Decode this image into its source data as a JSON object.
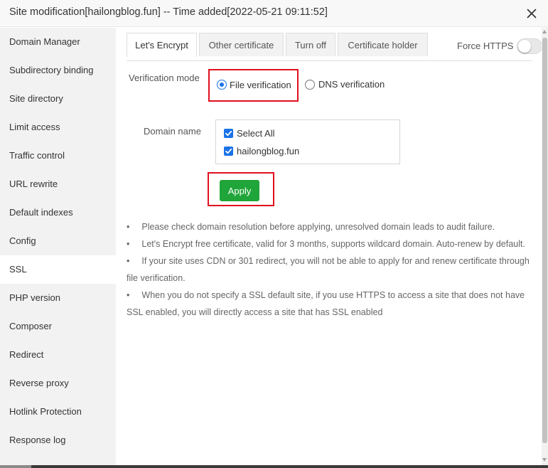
{
  "window": {
    "title": "Site modification[hailongblog.fun] -- Time added[2022-05-21 09:11:52]"
  },
  "sidebar": {
    "items": [
      {
        "label": "Domain Manager"
      },
      {
        "label": "Subdirectory binding"
      },
      {
        "label": "Site directory"
      },
      {
        "label": "Limit access"
      },
      {
        "label": "Traffic control"
      },
      {
        "label": "URL rewrite"
      },
      {
        "label": "Default indexes"
      },
      {
        "label": "Config"
      },
      {
        "label": "SSL",
        "active": true
      },
      {
        "label": "PHP version"
      },
      {
        "label": "Composer"
      },
      {
        "label": "Redirect"
      },
      {
        "label": "Reverse proxy"
      },
      {
        "label": "Hotlink Protection"
      },
      {
        "label": "Response log"
      }
    ]
  },
  "tabs": [
    {
      "label": "Let's Encrypt",
      "active": true
    },
    {
      "label": "Other certificate"
    },
    {
      "label": "Turn off"
    },
    {
      "label": "Certificate holder"
    }
  ],
  "force_https": {
    "label": "Force HTTPS",
    "enabled": false
  },
  "verification": {
    "label": "Verification mode",
    "options": [
      {
        "label": "File verification",
        "checked": true
      },
      {
        "label": "DNS verification",
        "checked": false
      }
    ]
  },
  "domain": {
    "label": "Domain name",
    "options": [
      {
        "label": "Select All",
        "checked": true
      },
      {
        "label": "hailongblog.fun",
        "checked": true
      }
    ]
  },
  "apply_button": {
    "label": "Apply"
  },
  "tips": [
    {
      "bullet": "•",
      "text": "Please check domain resolution before applying, unresolved domain leads to audit failure."
    },
    {
      "bullet": "•",
      "text": "Let's Encrypt free certificate, valid for 3 months, supports wildcard domain. Auto-renew by default."
    },
    {
      "bullet": "•",
      "text": "If your site uses CDN or 301 redirect, you will not be able to apply for and renew certificate through file verification."
    },
    {
      "bullet": "•",
      "text": "When you do not specify a SSL default site, if you use HTTPS to access a site that does not have SSL enabled, you will directly access a site that has SSL enabled"
    }
  ],
  "colors": {
    "primary": "#20a53a",
    "highlight": "#e0101e",
    "check": "#1a73e8",
    "sidebar_bg": "#f2f2f2"
  },
  "icons": {
    "close": "close-icon",
    "checkbox": "checkbox-checked-icon"
  }
}
